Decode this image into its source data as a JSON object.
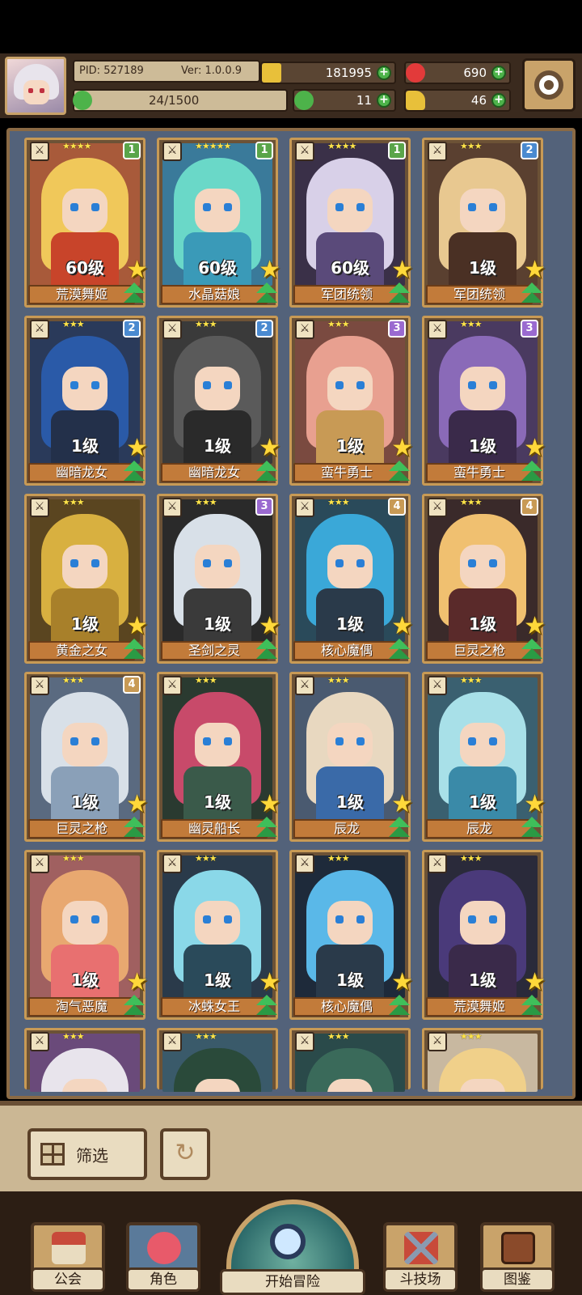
{
  "player": {
    "pid": "PID: 527189",
    "ver": "Ver: 1.0.0.9",
    "exp": "24/1500"
  },
  "resources": {
    "gold": "181995",
    "gems": "690",
    "clover": "11",
    "boot": "46"
  },
  "colors": {
    "gold": "#e8c03a",
    "gem": "#e23a3a",
    "clover": "#4db34a",
    "boot": "#e8c03a"
  },
  "cards": [
    {
      "name": "荒漠舞姬",
      "level": "60级",
      "stars": "★★★★",
      "badge": "1",
      "badge_color": "#5aa54a",
      "hair": "#f0c85a",
      "body": "#c8442a",
      "bg": "#a85a3a"
    },
    {
      "name": "水晶菇娘",
      "level": "60级",
      "stars": "★★★★★",
      "badge": "1",
      "badge_color": "#5aa54a",
      "hair": "#6ad8c8",
      "body": "#3a9ab8",
      "bg": "#3a7a9a"
    },
    {
      "name": "军团统领",
      "level": "60级",
      "stars": "★★★★",
      "badge": "1",
      "badge_color": "#5aa54a",
      "hair": "#d8d0e8",
      "body": "#5a4a7a",
      "bg": "#3a3048"
    },
    {
      "name": "军团统领",
      "level": "1级",
      "stars": "★★★",
      "badge": "2",
      "badge_color": "#4a8ad0",
      "hair": "#e8c890",
      "body": "#4a3024",
      "bg": "#5a4030"
    },
    {
      "name": "幽暗龙女",
      "level": "1级",
      "stars": "★★★",
      "badge": "2",
      "badge_color": "#4a8ad0",
      "hair": "#2a5aa8",
      "body": "#23304a",
      "bg": "#2a3a5a"
    },
    {
      "name": "幽暗龙女",
      "level": "1级",
      "stars": "★★★",
      "badge": "2",
      "badge_color": "#4a8ad0",
      "hair": "#5a5a5a",
      "body": "#2a2a2a",
      "bg": "#3a3a3a"
    },
    {
      "name": "蛮牛勇士",
      "level": "1级",
      "stars": "★★★",
      "badge": "3",
      "badge_color": "#9a6ad0",
      "hair": "#e8a090",
      "body": "#c89a55",
      "bg": "#7a4a40"
    },
    {
      "name": "蛮牛勇士",
      "level": "1级",
      "stars": "★★★",
      "badge": "3",
      "badge_color": "#9a6ad0",
      "hair": "#8a6ab8",
      "body": "#3a2a4a",
      "bg": "#4a3a60"
    },
    {
      "name": "黄金之女",
      "level": "1级",
      "stars": "★★★",
      "badge": "",
      "badge_color": "#000000",
      "hair": "#d8b040",
      "body": "#a8802a",
      "bg": "#5a4520"
    },
    {
      "name": "圣剑之灵",
      "level": "1级",
      "stars": "★★★",
      "badge": "3",
      "badge_color": "#9a6ad0",
      "hair": "#d8e0e8",
      "body": "#3a3a3a",
      "bg": "#2a2a2a"
    },
    {
      "name": "核心魔偶",
      "level": "1级",
      "stars": "★★★",
      "badge": "4",
      "badge_color": "#c89a55",
      "hair": "#3aa8d8",
      "body": "#2a3a4a",
      "bg": "#2a4a5a"
    },
    {
      "name": "巨灵之枪",
      "level": "1级",
      "stars": "★★★",
      "badge": "4",
      "badge_color": "#c89a55",
      "hair": "#f0c070",
      "body": "#5a2a2a",
      "bg": "#3a2a2a"
    },
    {
      "name": "巨灵之枪",
      "level": "1级",
      "stars": "★★★",
      "badge": "4",
      "badge_color": "#c89a55",
      "hair": "#d8e0e8",
      "body": "#8aa0b8",
      "bg": "#5a6a80"
    },
    {
      "name": "幽灵船长",
      "level": "1级",
      "stars": "★★★",
      "badge": "",
      "badge_color": "#000000",
      "hair": "#c84a6a",
      "body": "#3a5a4a",
      "bg": "#2a3a30"
    },
    {
      "name": "辰龙",
      "level": "1级",
      "stars": "★★★",
      "badge": "",
      "badge_color": "#000000",
      "hair": "#e8d8c0",
      "body": "#3a6aa8",
      "bg": "#4a5a70"
    },
    {
      "name": "辰龙",
      "level": "1级",
      "stars": "★★★",
      "badge": "",
      "badge_color": "#000000",
      "hair": "#a8e0e8",
      "body": "#3a8aa8",
      "bg": "#3a6070"
    },
    {
      "name": "淘气恶魔",
      "level": "1级",
      "stars": "★★★",
      "badge": "",
      "badge_color": "#000000",
      "hair": "#e8a870",
      "body": "#e87070",
      "bg": "#a06060"
    },
    {
      "name": "冰蛛女王",
      "level": "1级",
      "stars": "★★★",
      "badge": "",
      "badge_color": "#000000",
      "hair": "#8ad8e8",
      "body": "#2a4a5a",
      "bg": "#2a3a4a"
    },
    {
      "name": "核心魔偶",
      "level": "1级",
      "stars": "★★★",
      "badge": "",
      "badge_color": "#000000",
      "hair": "#5ab8e8",
      "body": "#2a3a4a",
      "bg": "#1e2a3a"
    },
    {
      "name": "荒漠舞姬",
      "level": "1级",
      "stars": "★★★",
      "badge": "",
      "badge_color": "#000000",
      "hair": "#4a3a7a",
      "body": "#3a2a4a",
      "bg": "#2a2a3a"
    }
  ],
  "partial_cards": [
    {
      "stars": "★★★",
      "hair": "#e8e4ec",
      "bg": "#6a4a7a"
    },
    {
      "stars": "★★★",
      "hair": "#2a4a3a",
      "bg": "#3a5a6a"
    },
    {
      "stars": "★★★",
      "hair": "#3a6a5a",
      "bg": "#2a4a4a"
    },
    {
      "stars": "★★★",
      "hair": "#f0d08a",
      "bg": "#c8b8a0"
    }
  ],
  "controls": {
    "filter_label": "筛选"
  },
  "nav": {
    "guild": "公会",
    "role": "角色",
    "adventure": "开始冒险",
    "arena": "斗技场",
    "codex": "图鉴"
  }
}
